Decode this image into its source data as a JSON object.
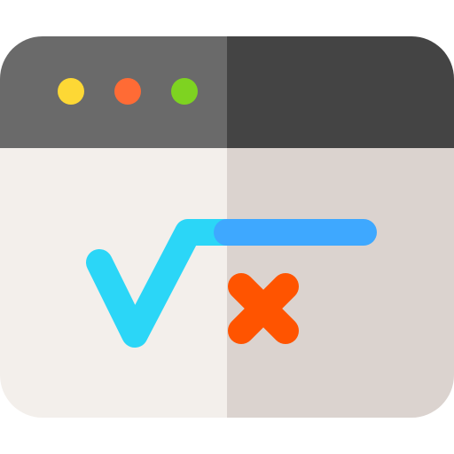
{
  "icon": {
    "name": "math-formula-browser-window-icon",
    "colors": {
      "titlebar_left": "#6a6a6a",
      "titlebar_right": "#444444",
      "content_left": "#f3efeb",
      "content_right": "#dbd3cf",
      "dot_yellow": "#fdd835",
      "dot_orange": "#ff6b35",
      "dot_green": "#7ed321",
      "root_left": "#2bd6f7",
      "root_right": "#3ea8ff",
      "cross": "#ff5400"
    },
    "window_dots": [
      "close-dot",
      "minimize-dot",
      "maximize-dot"
    ]
  }
}
